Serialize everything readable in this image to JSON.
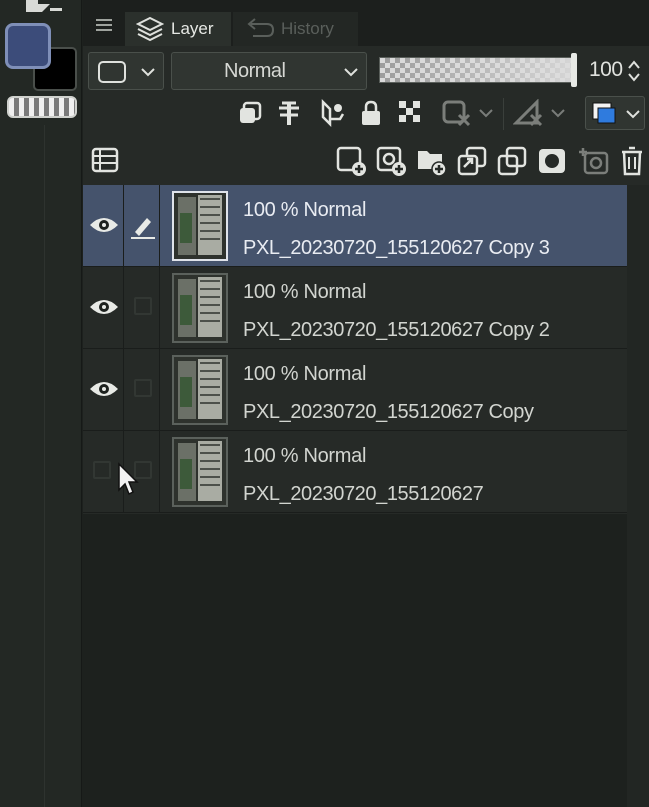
{
  "tabs": {
    "menu_icon": "hamburger-icon",
    "layer_label": "Layer",
    "history_label": "History"
  },
  "toolbar": {
    "blend_mode": "Normal",
    "opacity_value": "100",
    "opacity_fraction": 1.0
  },
  "colors": {
    "main_color": "#3c4c7a",
    "sub_color": "#000000",
    "selected_row": "#45536c",
    "panel_bg": "#262a27"
  },
  "layers": [
    {
      "mode": "100 % Normal",
      "name": "PXL_20230720_155120627 Copy 3",
      "visible": true,
      "editing": true,
      "selected": true
    },
    {
      "mode": "100 % Normal",
      "name": "PXL_20230720_155120627 Copy 2",
      "visible": true,
      "editing": false,
      "selected": false
    },
    {
      "mode": "100 % Normal",
      "name": "PXL_20230720_155120627 Copy",
      "visible": true,
      "editing": false,
      "selected": false
    },
    {
      "mode": "100 % Normal",
      "name": "PXL_20230720_155120627",
      "visible": false,
      "editing": false,
      "selected": false
    }
  ]
}
